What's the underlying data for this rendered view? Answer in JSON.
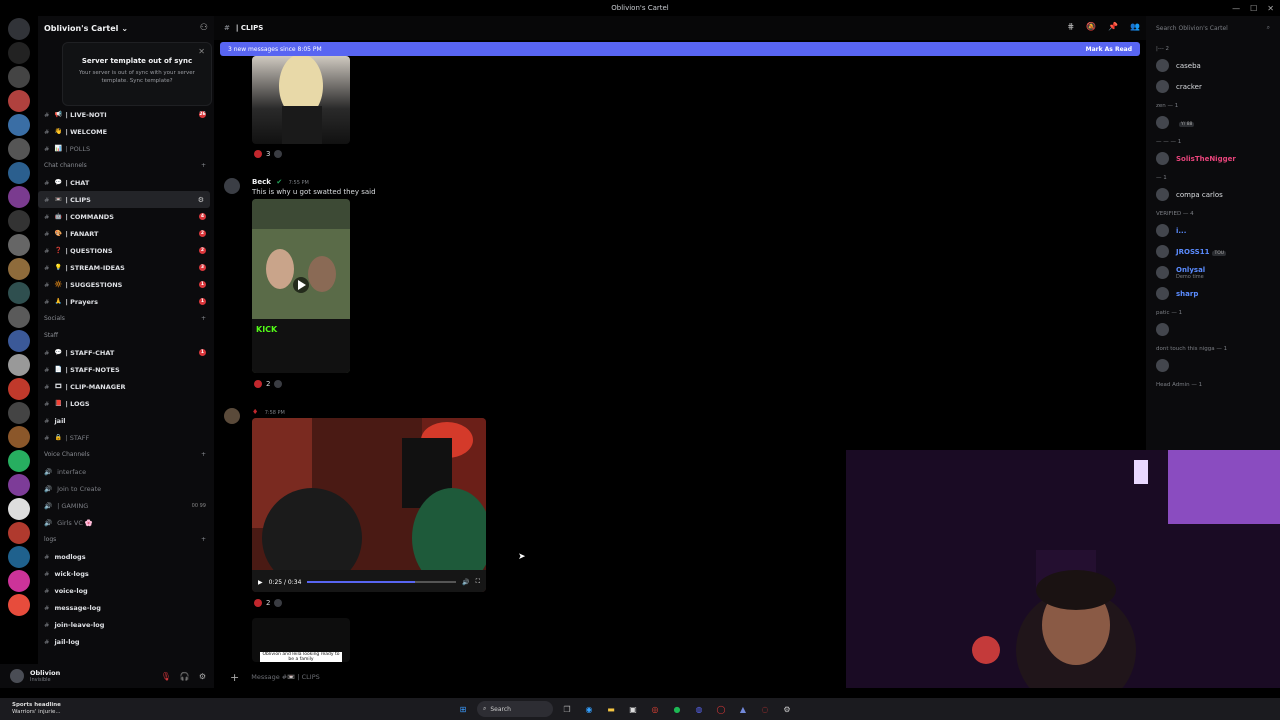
{
  "window": {
    "title": "Oblivion's Cartel"
  },
  "guild": {
    "name": "Oblivion's Cartel",
    "toast_title": "Server template out of sync",
    "toast_body": "Your server is out of sync with your server template. Sync template?"
  },
  "channels": {
    "top": [
      {
        "name": "| LIVE-NOTI",
        "emoji": "📢",
        "badge": "26"
      },
      {
        "name": "| WELCOME",
        "emoji": "👋",
        "badge": ""
      },
      {
        "name": "| POLLS",
        "emoji": "📊",
        "badge": "",
        "muted": true
      }
    ],
    "chat_category": "Chat channels",
    "chat": [
      {
        "name": "| CHAT",
        "emoji": "💬",
        "badge": ""
      },
      {
        "name": "| CLIPS",
        "emoji": "📼",
        "badge": "",
        "selected": true
      },
      {
        "name": "| COMMANDS",
        "emoji": "🤖",
        "badge": "4"
      },
      {
        "name": "| FANART",
        "emoji": "🎨",
        "badge": "2"
      },
      {
        "name": "| QUESTIONS",
        "emoji": "❓",
        "badge": "2"
      },
      {
        "name": "| STREAM-IDEAS",
        "emoji": "💡",
        "badge": "3"
      },
      {
        "name": "| SUGGESTIONS",
        "emoji": "🔆",
        "badge": "1"
      },
      {
        "name": "| Prayers",
        "emoji": "🙏",
        "badge": "1"
      }
    ],
    "socials_category": "Socials",
    "staff_category": "Staff",
    "staff": [
      {
        "name": "| STAFF-CHAT",
        "emoji": "💬",
        "badge": "1"
      },
      {
        "name": "| STAFF-NOTES",
        "emoji": "📄",
        "badge": ""
      },
      {
        "name": "| CLIP-MANAGER",
        "emoji": "🎞",
        "badge": ""
      },
      {
        "name": "| LOGS",
        "emoji": "📕",
        "badge": ""
      },
      {
        "name": "jail",
        "emoji": "",
        "badge": ""
      },
      {
        "name": "| STAFF",
        "emoji": "🔒",
        "badge": "",
        "muted": true
      }
    ],
    "voice_category": "Voice Channels",
    "voice": [
      {
        "name": "interface"
      },
      {
        "name": "Join to Create"
      },
      {
        "name": "| GAMING",
        "extra": "00 99"
      },
      {
        "name": "Girls VC 🌸"
      }
    ],
    "logs_category": "logs",
    "logs": [
      {
        "name": "modlogs"
      },
      {
        "name": "wick-logs"
      },
      {
        "name": "voice-log"
      },
      {
        "name": "message-log"
      },
      {
        "name": "join-leave-log"
      },
      {
        "name": "jail-log"
      }
    ]
  },
  "user": {
    "name": "Oblivion",
    "status": "Invisible"
  },
  "chat": {
    "channel": "| CLIPS",
    "new_messages": "3 new messages since 8:05 PM",
    "mark_read": "Mark As Read",
    "msg1_reactions": "3",
    "msg2": {
      "author": "Beck",
      "time": "7:55 PM",
      "text": "This is why u got swatted they said",
      "reactions": "2",
      "kick": "KICK"
    },
    "msg3": {
      "time": "7:58 PM",
      "reactions": "2",
      "video_time": "0:25 / 0:34",
      "video_progress": 0.72
    },
    "msg4_caption": "Oblivion and leila looking ready to be a family",
    "composer_placeholder": "Message #📼 | CLIPS"
  },
  "members": {
    "search_placeholder": "Search Oblivion's Cartel",
    "groups": [
      {
        "label": "|--- 2",
        "items": [
          {
            "name": "caseba"
          },
          {
            "name": "cracker"
          }
        ]
      },
      {
        "label": "zen — 1",
        "items": [
          {
            "name": "",
            "tag": "Y/ 88"
          }
        ]
      },
      {
        "label": "— — — 1",
        "items": [
          {
            "name": "SolisTheNigger",
            "color": "#e8447b"
          }
        ]
      },
      {
        "label": "— 1",
        "items": [
          {
            "name": "compa carlos"
          }
        ]
      },
      {
        "label": "VERIFIED — 4",
        "items": [
          {
            "name": "i...",
            "color": "#5b8cff"
          },
          {
            "name": "JROSS11",
            "color": "#5b8cff",
            "tag": "TOU"
          },
          {
            "name": "Onlysal",
            "color": "#5b8cff",
            "sub": "Demo time"
          },
          {
            "name": "sharp",
            "color": "#5b8cff"
          }
        ]
      },
      {
        "label": "patic — 1",
        "items": [
          {
            "name": ""
          }
        ]
      },
      {
        "label": "dont touch this nigga — 1",
        "items": [
          {
            "name": ""
          }
        ]
      },
      {
        "label": "Head Admin — 1",
        "items": []
      }
    ]
  },
  "taskbar": {
    "news_title": "Sports headline",
    "news_sub": "Warriors' injurie...",
    "search": "Search"
  },
  "colors": {
    "accent": "#5865f2",
    "badge": "#da373c"
  }
}
